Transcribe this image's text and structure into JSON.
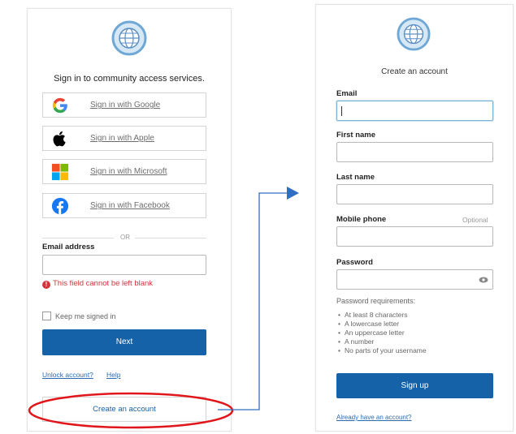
{
  "left": {
    "heading": "Sign in to community access services.",
    "social": [
      {
        "label": "Sign in with Google",
        "icon": "google-icon"
      },
      {
        "label": "Sign in with Apple",
        "icon": "apple-icon"
      },
      {
        "label": "Sign in with Microsoft",
        "icon": "microsoft-icon"
      },
      {
        "label": "Sign in with Facebook",
        "icon": "facebook-icon"
      }
    ],
    "divider": "OR",
    "email_label": "Email address",
    "email_value": "",
    "error": "This field cannot be left blank",
    "keep_signed_in": "Keep me signed in",
    "next_button": "Next",
    "unlock_link": "Unlock account?",
    "help_link": "Help",
    "create_account_button": "Create an account"
  },
  "right": {
    "heading": "Create an account",
    "email_label": "Email",
    "first_name_label": "First name",
    "last_name_label": "Last name",
    "mobile_label": "Mobile phone",
    "optional": "Optional",
    "password_label": "Password",
    "requirements_title": "Password requirements:",
    "requirements": [
      "At least 8 characters",
      "A lowercase letter",
      "An uppercase letter",
      "A number",
      "No parts of your username"
    ],
    "signup_button": "Sign up",
    "already_link": "Already have an account?"
  },
  "colors": {
    "primary": "#1662a8",
    "error": "#d4333a",
    "annotation_circle": "#e0161b",
    "arrow": "#2f6fc1"
  }
}
